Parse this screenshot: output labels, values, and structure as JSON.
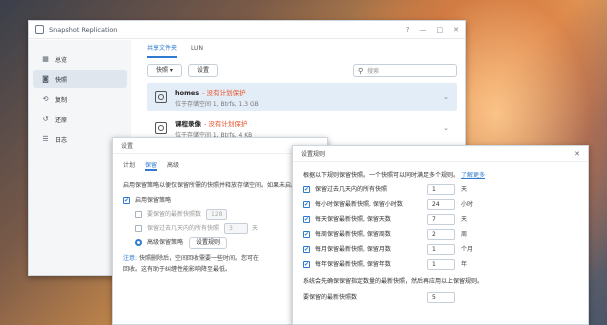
{
  "main_window": {
    "title": "Snapshot Replication",
    "controls": [
      "?",
      "—",
      "□",
      "✕"
    ],
    "sidebar": [
      {
        "label": "总览",
        "icon": "overview-icon",
        "glyph": "▦"
      },
      {
        "label": "快照",
        "icon": "camera-icon",
        "glyph": "◙"
      },
      {
        "label": "复制",
        "icon": "replication-icon",
        "glyph": "⟲"
      },
      {
        "label": "还原",
        "icon": "restore-icon",
        "glyph": "↺"
      },
      {
        "label": "日志",
        "icon": "log-icon",
        "glyph": "☰"
      }
    ],
    "tabs": [
      "共享文件夹",
      "LUN"
    ],
    "toolbar": {
      "snapshot": "快照",
      "settings": "设置",
      "search_placeholder": "搜索"
    },
    "items": [
      {
        "name": "homes",
        "status": "- 没有计划保护",
        "sub": "位于存储空间 1, Btrfs, 1.3 GB"
      },
      {
        "name": "课程录像",
        "status": "- 没有计划保护",
        "sub": "位于存储空间 1, Btrfs, 4 KB"
      }
    ]
  },
  "settings_dialog": {
    "title": "设置",
    "tabs": [
      "计划",
      "保留",
      "高级"
    ],
    "desc": "启用保留策略以便仅保留所需的快照并释放存储空间。如果未启用",
    "enable_retention": "启用保留策略",
    "opt_latest": "要保留的最新快照数",
    "opt_latest_value": "128",
    "opt_days": "保留过去几天内的所有快照",
    "opt_days_value": "3",
    "opt_days_unit": "天",
    "opt_advanced": "高级保留策略",
    "btn_set_rules": "设置规则",
    "note_label": "注意:",
    "note_text": "快照删除后，空间回收需要一些时间。您可在",
    "note_text2": "回收。这有助于纠缠性能影响降至最低。"
  },
  "rules_dialog": {
    "title": "设置规则",
    "close": "✕",
    "intro": "根据以下规则保留快照。一个快照可以同时满足多个规则。",
    "learn_more": "了解更多",
    "rules": [
      {
        "label": "保留过去几天内的所有快照",
        "value": "1",
        "unit": "天"
      },
      {
        "label": "每小时保留最新快照, 保留小时数",
        "value": "24",
        "unit": "小时"
      },
      {
        "label": "每天保留最新快照, 保留天数",
        "value": "7",
        "unit": "天"
      },
      {
        "label": "每周保留最新快照, 保留周数",
        "value": "2",
        "unit": "周"
      },
      {
        "label": "每月保留最新快照, 保留月数",
        "value": "1",
        "unit": "个月"
      },
      {
        "label": "每年保留最新快照, 保留年数",
        "value": "1",
        "unit": "年"
      }
    ],
    "footer": "系统会先确保保留指定数量的最新快照，然后再应用以上保留规则。",
    "min_keep_label": "要保留的最新快照数",
    "min_keep_value": "5"
  }
}
